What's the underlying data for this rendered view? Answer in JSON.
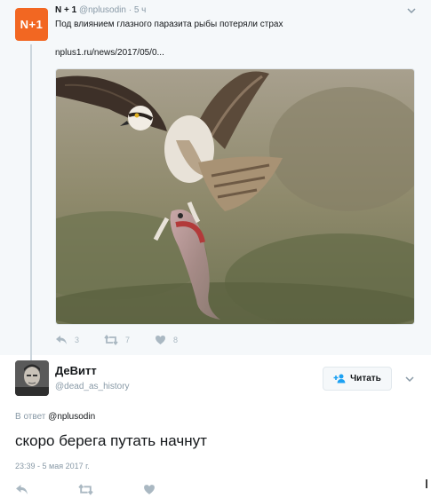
{
  "parent_tweet": {
    "avatar_text": "N+1",
    "author_name": "N + 1",
    "handle": "@nplusodin",
    "dot": "·",
    "time": "5 ч",
    "text": "Под влиянием глазного паразита рыбы потеряли страх",
    "link": "nplus1.ru/news/2017/05/0...",
    "actions": {
      "reply_count": "3",
      "retweet_count": "7",
      "like_count": "8"
    }
  },
  "reply_tweet": {
    "author_name": "ДеВитт",
    "handle": "@dead_as_history",
    "follow_label": "Читать",
    "reply_to_prefix": "В ответ",
    "reply_to_handle": "@nplusodin",
    "text": "скоро берега путать начнут",
    "timestamp": "23:39 - 5 мая 2017 г."
  },
  "icons": [
    "chevron-down-icon",
    "reply-icon",
    "retweet-icon",
    "heart-icon",
    "follow-person-icon"
  ],
  "colors": {
    "brand_orange": "#f26722",
    "muted_text": "#8899a6",
    "action_icon": "#aab8c2",
    "thread_line": "#ccd6dd"
  }
}
